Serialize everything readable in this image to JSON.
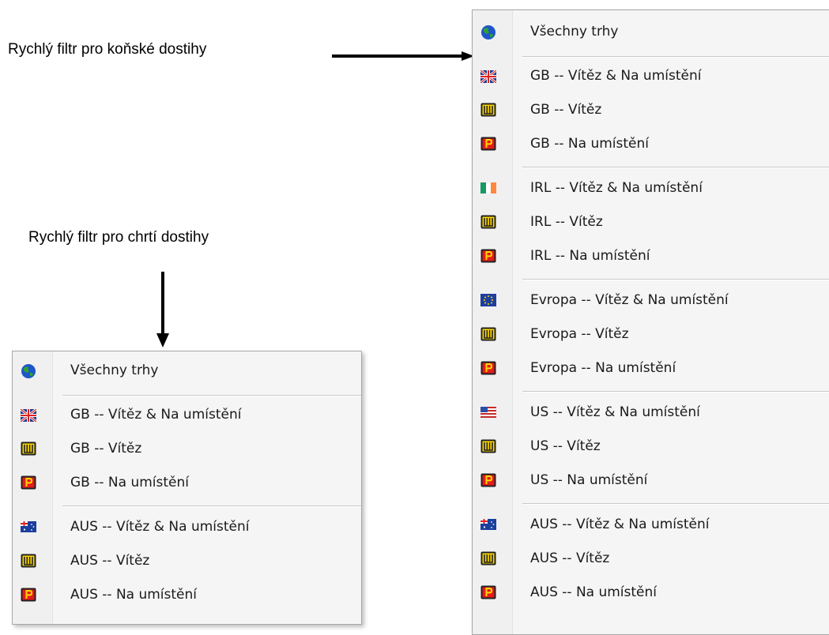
{
  "captions": {
    "horse": "Rychlý filtr pro koňské dostihy",
    "greyhound": "Rychlý filtr pro chrtí dostihy"
  },
  "colors": {
    "win_badge": "#ffd800",
    "place_badge": "#e51b1b",
    "globe_blue": "#1d56c9",
    "globe_green": "#2fa12f"
  },
  "horse_menu": {
    "items": [
      {
        "icon": "globe-icon",
        "label": "Všechny trhy"
      },
      {
        "icon": "gb-flag-icon",
        "label": "GB -- Vítěz & Na umístění"
      },
      {
        "icon": "win-badge-icon",
        "label": "GB -- Vítěz"
      },
      {
        "icon": "place-badge-icon",
        "label": "GB -- Na umístění"
      },
      {
        "icon": "ireland-flag-icon",
        "label": "IRL -- Vítěz & Na umístění"
      },
      {
        "icon": "win-badge-icon",
        "label": "IRL -- Vítěz"
      },
      {
        "icon": "place-badge-icon",
        "label": "IRL -- Na umístění"
      },
      {
        "icon": "eu-flag-icon",
        "label": "Evropa -- Vítěz & Na umístění"
      },
      {
        "icon": "win-badge-icon",
        "label": "Evropa -- Vítěz"
      },
      {
        "icon": "place-badge-icon",
        "label": "Evropa -- Na umístění"
      },
      {
        "icon": "us-flag-icon",
        "label": "US -- Vítěz & Na umístění"
      },
      {
        "icon": "win-badge-icon",
        "label": "US -- Vítěz"
      },
      {
        "icon": "place-badge-icon",
        "label": "US -- Na umístění"
      },
      {
        "icon": "aus-flag-icon",
        "label": "AUS -- Vítěz & Na umístění"
      },
      {
        "icon": "win-badge-icon",
        "label": "AUS -- Vítěz"
      },
      {
        "icon": "place-badge-icon",
        "label": "AUS -- Na umístění"
      }
    ]
  },
  "greyhound_menu": {
    "items": [
      {
        "icon": "globe-icon",
        "label": "Všechny trhy"
      },
      {
        "icon": "gb-flag-icon",
        "label": "GB -- Vítěz & Na umístění"
      },
      {
        "icon": "win-badge-icon",
        "label": "GB -- Vítěz"
      },
      {
        "icon": "place-badge-icon",
        "label": "GB -- Na umístění"
      },
      {
        "icon": "aus-flag-icon",
        "label": "AUS -- Vítěz & Na umístění"
      },
      {
        "icon": "win-badge-icon",
        "label": "AUS -- Vítěz"
      },
      {
        "icon": "place-badge-icon",
        "label": "AUS -- Na umístění"
      }
    ]
  }
}
